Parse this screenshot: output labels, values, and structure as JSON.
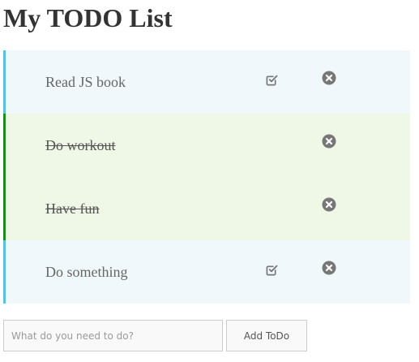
{
  "page": {
    "title": "My TODO List"
  },
  "todos": [
    {
      "text": "Read JS book",
      "completed": false,
      "check_icon": "checkbox-checked-icon",
      "delete_icon": "circle-x-icon"
    },
    {
      "text": "Do workout",
      "completed": true,
      "delete_icon": "circle-x-icon"
    },
    {
      "text": "Have fun",
      "completed": true,
      "delete_icon": "circle-x-icon"
    },
    {
      "text": "Do something",
      "completed": false,
      "check_icon": "checkbox-checked-icon",
      "delete_icon": "circle-x-icon"
    }
  ],
  "add_form": {
    "input_value": "",
    "input_placeholder": "What do you need to do?",
    "button_label": "Add ToDo"
  },
  "colors": {
    "active_row_bg": "#f1f8fb",
    "active_row_border": "#5bc0de",
    "done_row_bg": "#eff7e7",
    "done_row_border": "#1f8a1f",
    "icon_gray": "#777777"
  }
}
